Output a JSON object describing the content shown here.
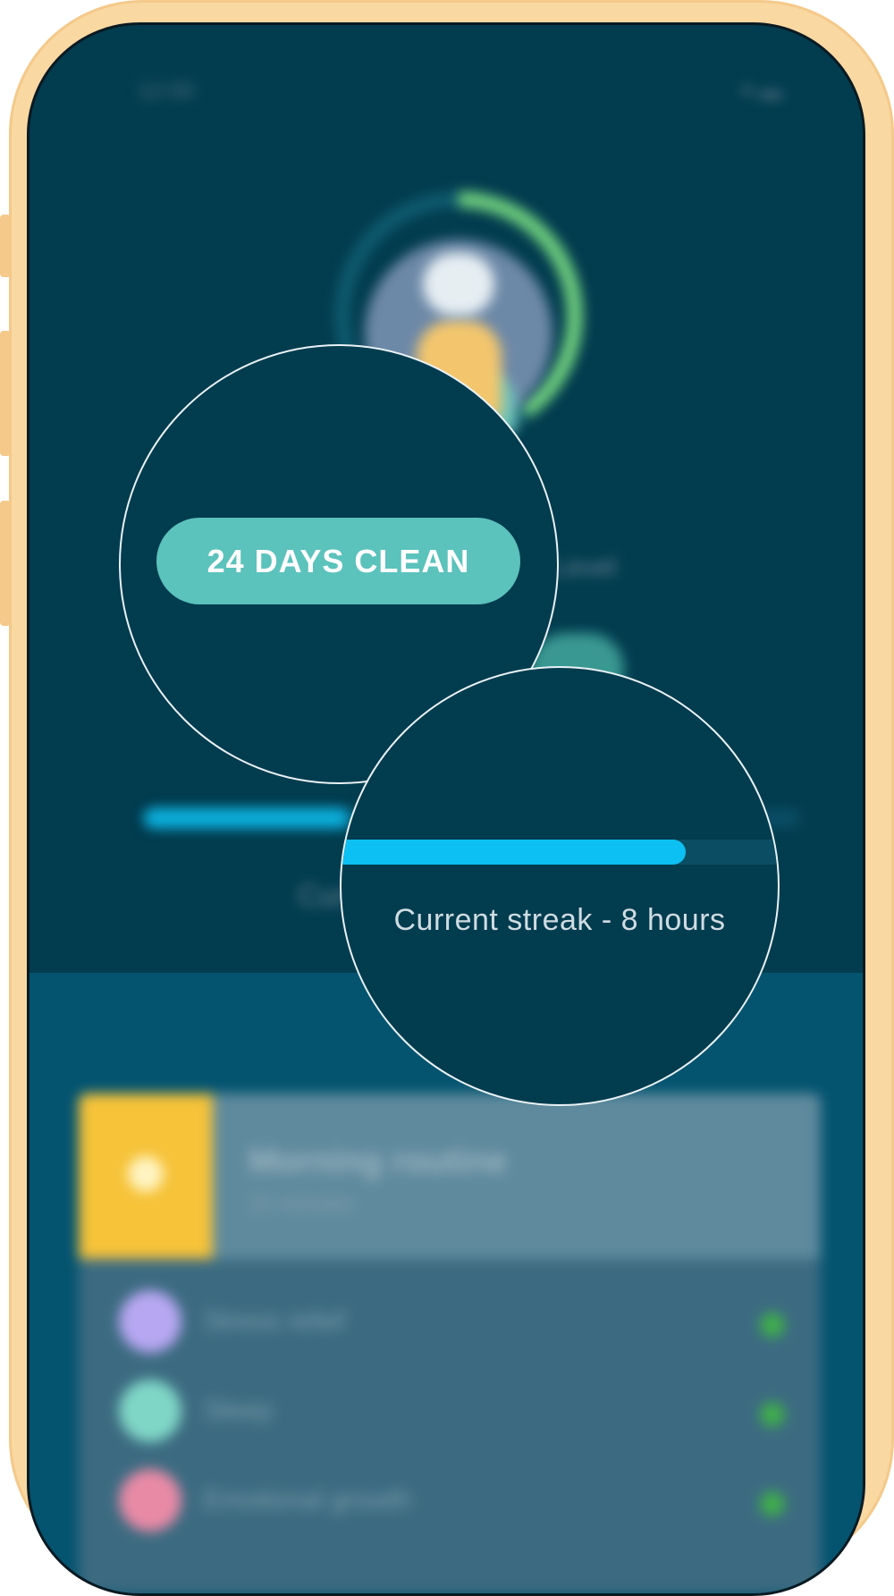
{
  "status_bar": {
    "time": "12:00",
    "icons": "▾ ▬"
  },
  "profile": {
    "days_clean_label": "24 DAYS CLEAN",
    "blurred_caption": "Level"
  },
  "streak": {
    "label": "Current streak - 8 hours",
    "progress": 0.77,
    "blurred_caption": "Cur"
  },
  "routine": {
    "title": "Morning routine",
    "subtitle": "15 minutes"
  },
  "list": [
    {
      "label": "Stress relief",
      "color": "#b7a7f2"
    },
    {
      "label": "Sleep",
      "color": "#7fd6c6"
    },
    {
      "label": "Emotional growth",
      "color": "#e88aa6"
    }
  ],
  "colors": {
    "accent": "#5bc2bc",
    "progress": "#0cc0f3",
    "background": "#023c4f",
    "frame": "#f9d8a2"
  }
}
